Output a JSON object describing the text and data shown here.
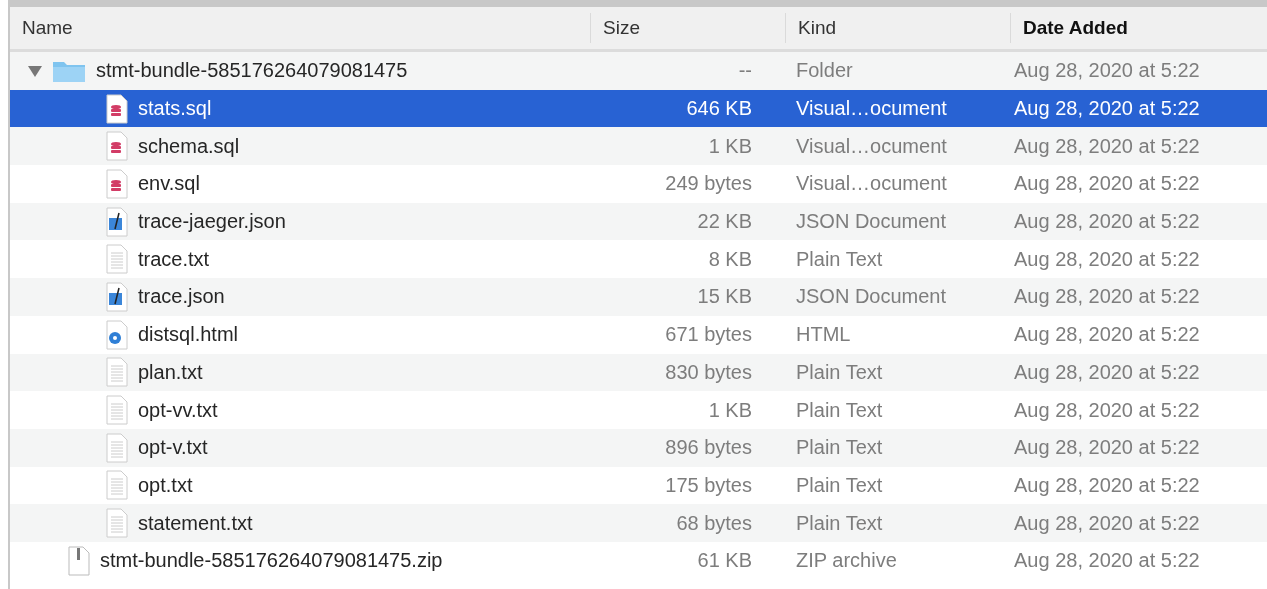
{
  "columns": [
    {
      "label": "Name",
      "sorted": false
    },
    {
      "label": "Size",
      "sorted": false
    },
    {
      "label": "Kind",
      "sorted": false
    },
    {
      "label": "Date Added",
      "sorted": true
    }
  ],
  "rows": [
    {
      "name": "stmt-bundle-585176264079081475",
      "size": "--",
      "kind_label": "Folder",
      "date": "Aug 28, 2020 at 5:22",
      "kind": "folder",
      "selected": false,
      "expanded": true,
      "children": [
        {
          "name": "stats.sql",
          "size": "646 KB",
          "kind_label": "Visual…ocument",
          "date": "Aug 28, 2020 at 5:22",
          "kind": "sql",
          "selected": true
        },
        {
          "name": "schema.sql",
          "size": "1 KB",
          "kind_label": "Visual…ocument",
          "date": "Aug 28, 2020 at 5:22",
          "kind": "sql",
          "selected": false
        },
        {
          "name": "env.sql",
          "size": "249 bytes",
          "kind_label": "Visual…ocument",
          "date": "Aug 28, 2020 at 5:22",
          "kind": "sql",
          "selected": false
        },
        {
          "name": "trace-jaeger.json",
          "size": "22 KB",
          "kind_label": "JSON Document",
          "date": "Aug 28, 2020 at 5:22",
          "kind": "json",
          "selected": false
        },
        {
          "name": "trace.txt",
          "size": "8 KB",
          "kind_label": "Plain Text",
          "date": "Aug 28, 2020 at 5:22",
          "kind": "text",
          "selected": false
        },
        {
          "name": "trace.json",
          "size": "15 KB",
          "kind_label": "JSON Document",
          "date": "Aug 28, 2020 at 5:22",
          "kind": "json",
          "selected": false
        },
        {
          "name": "distsql.html",
          "size": "671 bytes",
          "kind_label": "HTML",
          "date": "Aug 28, 2020 at 5:22",
          "kind": "html",
          "selected": false
        },
        {
          "name": "plan.txt",
          "size": "830 bytes",
          "kind_label": "Plain Text",
          "date": "Aug 28, 2020 at 5:22",
          "kind": "text",
          "selected": false
        },
        {
          "name": "opt-vv.txt",
          "size": "1 KB",
          "kind_label": "Plain Text",
          "date": "Aug 28, 2020 at 5:22",
          "kind": "text",
          "selected": false
        },
        {
          "name": "opt-v.txt",
          "size": "896 bytes",
          "kind_label": "Plain Text",
          "date": "Aug 28, 2020 at 5:22",
          "kind": "text",
          "selected": false
        },
        {
          "name": "opt.txt",
          "size": "175 bytes",
          "kind_label": "Plain Text",
          "date": "Aug 28, 2020 at 5:22",
          "kind": "text",
          "selected": false
        },
        {
          "name": "statement.txt",
          "size": "68 bytes",
          "kind_label": "Plain Text",
          "date": "Aug 28, 2020 at 5:22",
          "kind": "text",
          "selected": false
        }
      ]
    },
    {
      "name": "stmt-bundle-585176264079081475.zip",
      "size": "61 KB",
      "kind_label": "ZIP archive",
      "date": "Aug 28, 2020 at 5:22",
      "kind": "zip",
      "selected": false
    }
  ]
}
